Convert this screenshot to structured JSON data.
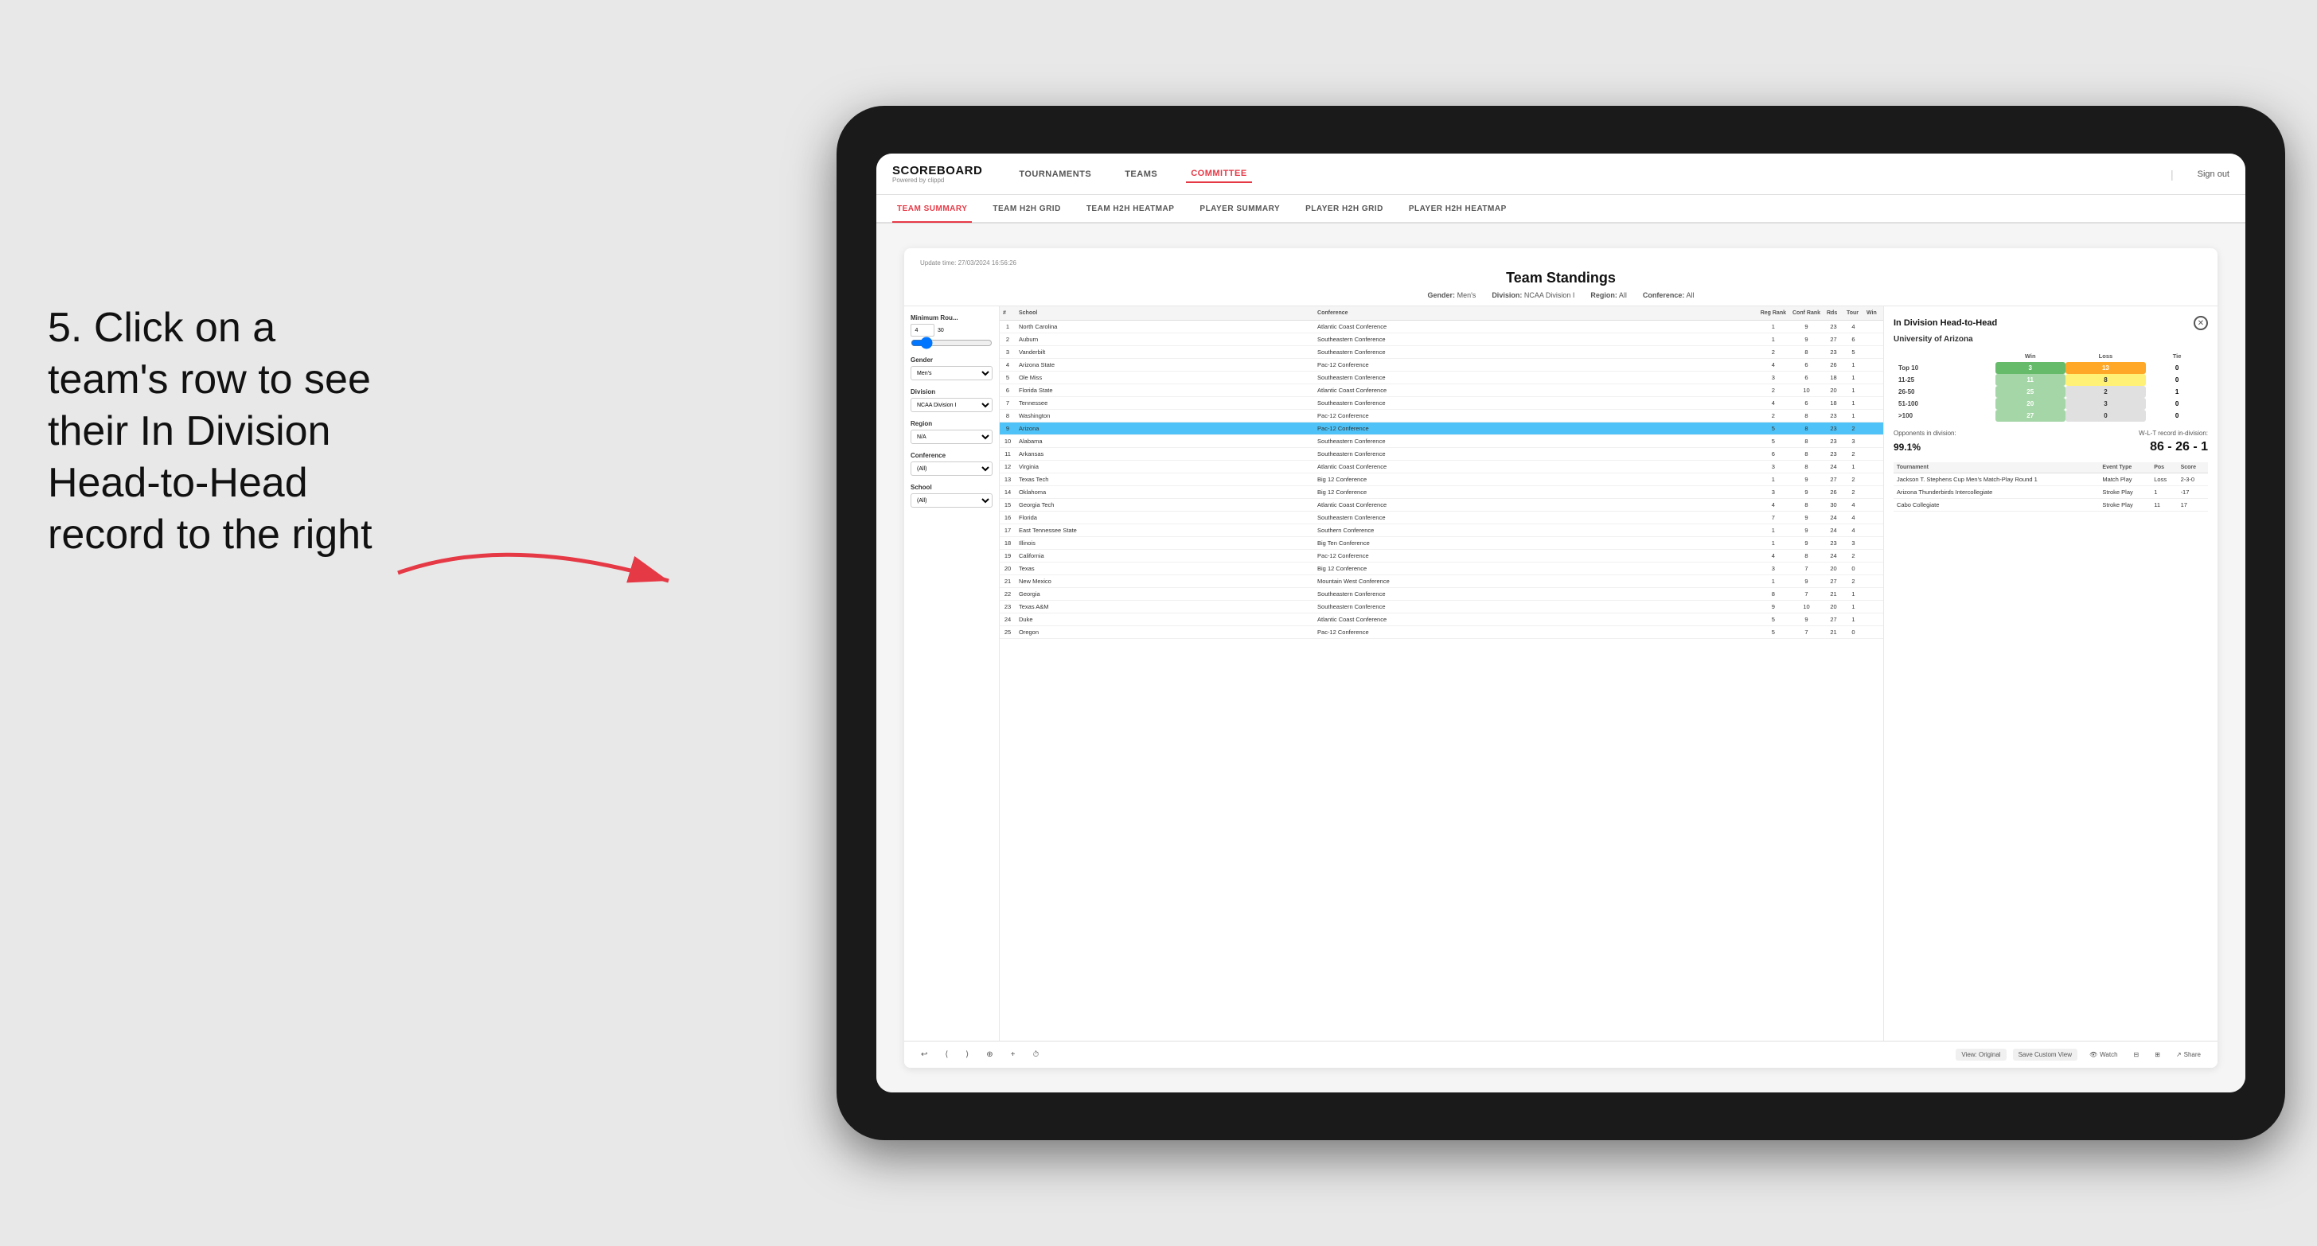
{
  "annotation": {
    "text": "5. Click on a team's row to see their In Division Head-to-Head record to the right"
  },
  "nav": {
    "logo": "SCOREBOARD",
    "logo_sub": "Powered by clippd",
    "items": [
      "TOURNAMENTS",
      "TEAMS",
      "COMMITTEE"
    ],
    "sign_out": "Sign out"
  },
  "sub_nav": {
    "items": [
      "TEAM SUMMARY",
      "TEAM H2H GRID",
      "TEAM H2H HEATMAP",
      "PLAYER SUMMARY",
      "PLAYER H2H GRID",
      "PLAYER H2H HEATMAP"
    ],
    "active": "PLAYER SUMMARY"
  },
  "panel": {
    "update_time": "Update time: 27/03/2024 16:56:26",
    "title": "Team Standings",
    "filters": {
      "gender_label": "Gender:",
      "gender_value": "Men's",
      "division_label": "Division:",
      "division_value": "NCAA Division I",
      "region_label": "Region:",
      "region_value": "All",
      "conference_label": "Conference:",
      "conference_value": "All"
    }
  },
  "left_filters": {
    "min_rounds_label": "Minimum Rou...",
    "min_rounds_value": "4",
    "min_rounds_max": "30",
    "gender_label": "Gender",
    "gender_options": [
      "Men's"
    ],
    "division_label": "Division",
    "division_options": [
      "NCAA Division I"
    ],
    "region_label": "Region",
    "region_options": [
      "N/A"
    ],
    "conference_label": "Conference",
    "conference_options": [
      "(All)"
    ],
    "school_label": "School",
    "school_options": [
      "(All)"
    ]
  },
  "table": {
    "headers": [
      "#",
      "School",
      "Conference",
      "Reg Rank",
      "Conf Rank",
      "Rds",
      "Tour",
      "Win"
    ],
    "rows": [
      {
        "rank": 1,
        "school": "North Carolina",
        "conference": "Atlantic Coast Conference",
        "reg_rank": 1,
        "conf_rank": 9,
        "rds": 23,
        "tour": 4,
        "win": ""
      },
      {
        "rank": 2,
        "school": "Auburn",
        "conference": "Southeastern Conference",
        "reg_rank": 1,
        "conf_rank": 9,
        "rds": 27,
        "tour": 6,
        "win": ""
      },
      {
        "rank": 3,
        "school": "Vanderbilt",
        "conference": "Southeastern Conference",
        "reg_rank": 2,
        "conf_rank": 8,
        "rds": 23,
        "tour": 5,
        "win": ""
      },
      {
        "rank": 4,
        "school": "Arizona State",
        "conference": "Pac-12 Conference",
        "reg_rank": 4,
        "conf_rank": 6,
        "rds": 26,
        "tour": 1,
        "win": ""
      },
      {
        "rank": 5,
        "school": "Ole Miss",
        "conference": "Southeastern Conference",
        "reg_rank": 3,
        "conf_rank": 6,
        "rds": 18,
        "tour": 1,
        "win": ""
      },
      {
        "rank": 6,
        "school": "Florida State",
        "conference": "Atlantic Coast Conference",
        "reg_rank": 2,
        "conf_rank": 10,
        "rds": 20,
        "tour": 1,
        "win": ""
      },
      {
        "rank": 7,
        "school": "Tennessee",
        "conference": "Southeastern Conference",
        "reg_rank": 4,
        "conf_rank": 6,
        "rds": 18,
        "tour": 1,
        "win": ""
      },
      {
        "rank": 8,
        "school": "Washington",
        "conference": "Pac-12 Conference",
        "reg_rank": 2,
        "conf_rank": 8,
        "rds": 23,
        "tour": 1,
        "win": ""
      },
      {
        "rank": 9,
        "school": "Arizona",
        "conference": "Pac-12 Conference",
        "reg_rank": 5,
        "conf_rank": 8,
        "rds": 23,
        "tour": 2,
        "win": "",
        "selected": true
      },
      {
        "rank": 10,
        "school": "Alabama",
        "conference": "Southeastern Conference",
        "reg_rank": 5,
        "conf_rank": 8,
        "rds": 23,
        "tour": 3,
        "win": ""
      },
      {
        "rank": 11,
        "school": "Arkansas",
        "conference": "Southeastern Conference",
        "reg_rank": 6,
        "conf_rank": 8,
        "rds": 23,
        "tour": 2,
        "win": ""
      },
      {
        "rank": 12,
        "school": "Virginia",
        "conference": "Atlantic Coast Conference",
        "reg_rank": 3,
        "conf_rank": 8,
        "rds": 24,
        "tour": 1,
        "win": ""
      },
      {
        "rank": 13,
        "school": "Texas Tech",
        "conference": "Big 12 Conference",
        "reg_rank": 1,
        "conf_rank": 9,
        "rds": 27,
        "tour": 2,
        "win": ""
      },
      {
        "rank": 14,
        "school": "Oklahoma",
        "conference": "Big 12 Conference",
        "reg_rank": 3,
        "conf_rank": 9,
        "rds": 26,
        "tour": 2,
        "win": ""
      },
      {
        "rank": 15,
        "school": "Georgia Tech",
        "conference": "Atlantic Coast Conference",
        "reg_rank": 4,
        "conf_rank": 8,
        "rds": 30,
        "tour": 4,
        "win": ""
      },
      {
        "rank": 16,
        "school": "Florida",
        "conference": "Southeastern Conference",
        "reg_rank": 7,
        "conf_rank": 9,
        "rds": 24,
        "tour": 4,
        "win": ""
      },
      {
        "rank": 17,
        "school": "East Tennessee State",
        "conference": "Southern Conference",
        "reg_rank": 1,
        "conf_rank": 9,
        "rds": 24,
        "tour": 4,
        "win": ""
      },
      {
        "rank": 18,
        "school": "Illinois",
        "conference": "Big Ten Conference",
        "reg_rank": 1,
        "conf_rank": 9,
        "rds": 23,
        "tour": 3,
        "win": ""
      },
      {
        "rank": 19,
        "school": "California",
        "conference": "Pac-12 Conference",
        "reg_rank": 4,
        "conf_rank": 8,
        "rds": 24,
        "tour": 2,
        "win": ""
      },
      {
        "rank": 20,
        "school": "Texas",
        "conference": "Big 12 Conference",
        "reg_rank": 3,
        "conf_rank": 7,
        "rds": 20,
        "tour": 0,
        "win": ""
      },
      {
        "rank": 21,
        "school": "New Mexico",
        "conference": "Mountain West Conference",
        "reg_rank": 1,
        "conf_rank": 9,
        "rds": 27,
        "tour": 2,
        "win": ""
      },
      {
        "rank": 22,
        "school": "Georgia",
        "conference": "Southeastern Conference",
        "reg_rank": 8,
        "conf_rank": 7,
        "rds": 21,
        "tour": 1,
        "win": ""
      },
      {
        "rank": 23,
        "school": "Texas A&M",
        "conference": "Southeastern Conference",
        "reg_rank": 9,
        "conf_rank": 10,
        "rds": 20,
        "tour": 1,
        "win": ""
      },
      {
        "rank": 24,
        "school": "Duke",
        "conference": "Atlantic Coast Conference",
        "reg_rank": 5,
        "conf_rank": 9,
        "rds": 27,
        "tour": 1,
        "win": ""
      },
      {
        "rank": 25,
        "school": "Oregon",
        "conference": "Pac-12 Conference",
        "reg_rank": 5,
        "conf_rank": 7,
        "rds": 21,
        "tour": 0,
        "win": ""
      }
    ]
  },
  "h2h": {
    "title": "In Division Head-to-Head",
    "team": "University of Arizona",
    "headers": [
      "",
      "Win",
      "Loss",
      "Tie"
    ],
    "rows": [
      {
        "label": "Top 10",
        "win": 3,
        "loss": 13,
        "tie": 0,
        "win_color": "green",
        "loss_color": "orange"
      },
      {
        "label": "11-25",
        "win": 11,
        "loss": 8,
        "tie": 0,
        "win_color": "light-green",
        "loss_color": "yellow"
      },
      {
        "label": "26-50",
        "win": 25,
        "loss": 2,
        "tie": 1,
        "win_color": "light-green",
        "loss_color": "gray"
      },
      {
        "label": "51-100",
        "win": 20,
        "loss": 3,
        "tie": 0,
        "win_color": "light-green",
        "loss_color": "gray"
      },
      {
        "label": ">100",
        "win": 27,
        "loss": 0,
        "tie": 0,
        "win_color": "light-green",
        "loss_color": "gray"
      }
    ],
    "opponents_label": "Opponents in division:",
    "opponents_value": "99.1%",
    "wlt_label": "W-L-T record in-division:",
    "wlt_value": "86 - 26 - 1",
    "tournament_headers": [
      "Tournament",
      "Event Type",
      "Pos",
      "Score"
    ],
    "tournaments": [
      {
        "name": "Jackson T. Stephens Cup Men's Match-Play Round 1",
        "type": "Match Play",
        "pos": "Loss",
        "score": "2-3-0"
      },
      {
        "name": "Arizona Thunderbirds Intercollegiate",
        "type": "Stroke Play",
        "pos": "1",
        "score": "-17"
      },
      {
        "name": "Cabo Collegiate",
        "type": "Stroke Play",
        "pos": "11",
        "score": "17"
      }
    ]
  },
  "toolbar": {
    "undo": "↩",
    "redo": "↪",
    "forward": "→",
    "copy": "⊕",
    "plus": "+",
    "clock": "⏱",
    "view_original": "View: Original",
    "save_custom": "Save Custom View",
    "watch": "Watch",
    "share": "Share"
  },
  "colors": {
    "accent": "#e63946",
    "selected_row": "#4fc3f7"
  }
}
